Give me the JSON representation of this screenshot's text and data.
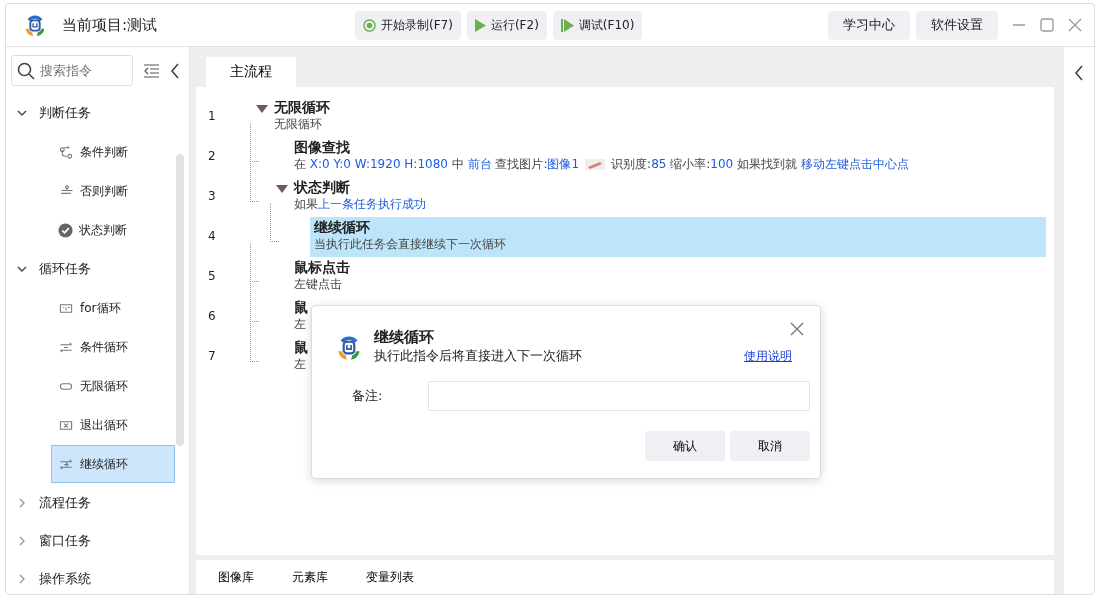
{
  "window": {
    "title": "当前项目:测试"
  },
  "toolbar": [
    {
      "label": "开始录制(F7)",
      "kind": "record"
    },
    {
      "label": "运行(F2)",
      "kind": "run"
    },
    {
      "label": "调试(F10)",
      "kind": "debug"
    }
  ],
  "header_buttons": [
    "学习中心",
    "软件设置"
  ],
  "sidebar": {
    "search": {
      "placeholder": "搜索指令"
    },
    "groups": [
      {
        "label": "判断任务",
        "expanded": true,
        "items": [
          {
            "label": "条件判断",
            "selected": false
          },
          {
            "label": "否则判断",
            "selected": false
          },
          {
            "label": "状态判断",
            "selected": false
          }
        ]
      },
      {
        "label": "循环任务",
        "expanded": true,
        "items": [
          {
            "label": "for循环",
            "selected": false
          },
          {
            "label": "条件循环",
            "selected": false
          },
          {
            "label": "无限循环",
            "selected": false
          },
          {
            "label": "退出循环",
            "selected": false
          },
          {
            "label": "继续循环",
            "selected": true
          }
        ]
      },
      {
        "label": "流程任务",
        "expanded": false
      },
      {
        "label": "窗口任务",
        "expanded": false
      },
      {
        "label": "操作系统",
        "expanded": false
      }
    ]
  },
  "tabs": [
    {
      "label": "主流程",
      "selected": true
    }
  ],
  "flow": [
    {
      "line": "1",
      "title": "无限循环",
      "expanded": true,
      "selected": false,
      "desc": [
        {
          "kind": "text",
          "spans": [
            {
              "text": "无限循环",
              "kind": "plain"
            }
          ]
        }
      ],
      "children": [
        {
          "line": "2",
          "title": "图像查找",
          "selected": false,
          "desc": [
            {
              "kind": "text",
              "spans": [
                {
                  "text": "在 ",
                  "kind": "plain"
                },
                {
                  "text": "X:0 Y:0 W:1920 H:1080",
                  "kind": "value"
                },
                {
                  "text": " 中 ",
                  "kind": "plain"
                },
                {
                  "text": "前台",
                  "kind": "value"
                },
                {
                  "text": " 查找图片:",
                  "kind": "plain"
                },
                {
                  "text": "图像1",
                  "kind": "value"
                }
              ]
            },
            {
              "kind": "thumbnail"
            },
            {
              "kind": "text",
              "spans": [
                {
                  "text": "识别度:",
                  "kind": "plain"
                },
                {
                  "text": "85",
                  "kind": "value"
                },
                {
                  "text": " 缩小率:",
                  "kind": "plain"
                },
                {
                  "text": "100",
                  "kind": "value"
                },
                {
                  "text": " 如果找到就 ",
                  "kind": "plain"
                },
                {
                  "text": "移动左键点击中心点",
                  "kind": "value"
                }
              ]
            }
          ]
        },
        {
          "line": "3",
          "title": "状态判断",
          "expanded": true,
          "selected": false,
          "desc": [
            {
              "kind": "text",
              "spans": [
                {
                  "text": "如果",
                  "kind": "plain"
                },
                {
                  "text": "上一条任务执行成功",
                  "kind": "value"
                }
              ]
            }
          ],
          "children": [
            {
              "line": "4",
              "title": "继续循环",
              "selected": true,
              "desc": [
                {
                  "kind": "text",
                  "spans": [
                    {
                      "text": "当执行此任务会直接继续下一次循环",
                      "kind": "plain"
                    }
                  ]
                }
              ]
            }
          ]
        },
        {
          "line": "5",
          "title": "鼠标点击",
          "selected": false,
          "desc": [
            {
              "kind": "text",
              "spans": [
                {
                  "text": "左键点击",
                  "kind": "plain"
                }
              ]
            }
          ]
        },
        {
          "line": "6",
          "title": "鼠",
          "selected": false,
          "desc": [
            {
              "kind": "text",
              "spans": [
                {
                  "text": "左",
                  "kind": "plain"
                }
              ]
            }
          ]
        },
        {
          "line": "7",
          "title": "鼠",
          "selected": false,
          "desc": [
            {
              "kind": "text",
              "spans": [
                {
                  "text": "左",
                  "kind": "plain"
                }
              ]
            }
          ]
        }
      ]
    }
  ],
  "dialog": {
    "title": "继续循环",
    "subtitle": "执行此指令后将直接进入下一次循环",
    "help_link": "使用说明",
    "note_label": "备注:",
    "buttons": [
      "确认",
      "取消"
    ]
  },
  "bottom_tabs": [
    "图像库",
    "元素库",
    "变量列表"
  ]
}
